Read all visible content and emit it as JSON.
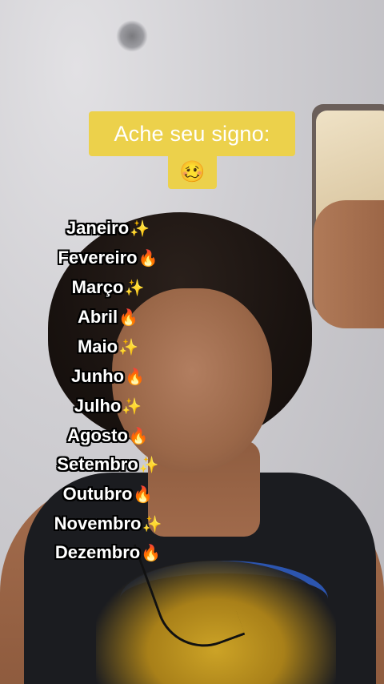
{
  "overlay": {
    "title": "Ache seu signo:",
    "title_emoji": "🥴"
  },
  "months": [
    {
      "label": "Janeiro",
      "emoji": "✨"
    },
    {
      "label": "Fevereiro",
      "emoji": "🔥"
    },
    {
      "label": "Março",
      "emoji": "✨"
    },
    {
      "label": "Abril",
      "emoji": "🔥"
    },
    {
      "label": "Maio",
      "emoji": "✨"
    },
    {
      "label": "Junho",
      "emoji": "🔥"
    },
    {
      "label": "Julho",
      "emoji": "✨"
    },
    {
      "label": "Agosto",
      "emoji": "🔥"
    },
    {
      "label": "Setembro",
      "emoji": "✨"
    },
    {
      "label": "Outubro",
      "emoji": "🔥"
    },
    {
      "label": "Novembro",
      "emoji": "✨"
    },
    {
      "label": "Dezembro",
      "emoji": "🔥"
    }
  ],
  "colors": {
    "caption_bg": "#ecd14b",
    "caption_text": "#ffffff",
    "month_outline": "#000000"
  }
}
